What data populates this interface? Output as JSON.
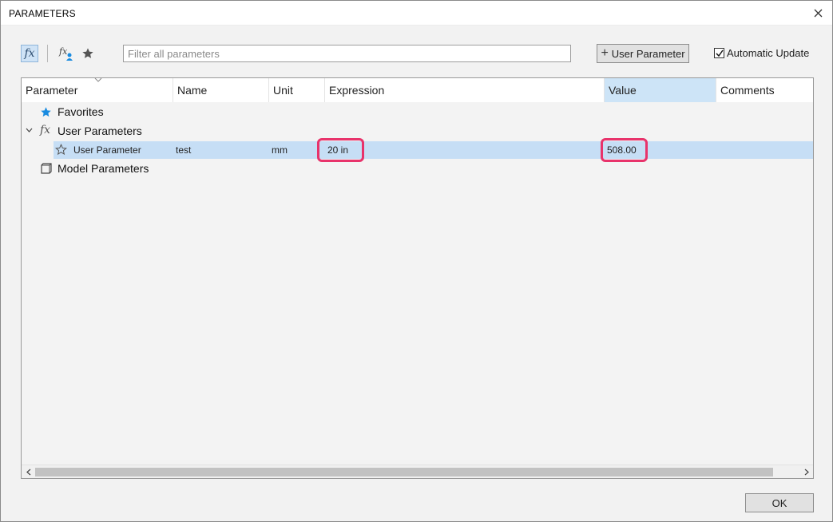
{
  "window": {
    "title": "PARAMETERS"
  },
  "toolbar": {
    "fx_glyph": "fx",
    "filter_placeholder": "Filter all parameters",
    "add_button_icon": "+",
    "add_button_label": "User Parameter",
    "auto_update_label": "Automatic Update",
    "auto_update_checked": true
  },
  "table": {
    "columns": [
      "Parameter",
      "Name",
      "Unit",
      "Expression",
      "Value",
      "Comments"
    ],
    "sorted_column": "Value",
    "groups": {
      "favorites": "Favorites",
      "user_parameters": "User Parameters",
      "model_parameters": "Model Parameters"
    },
    "rows": [
      {
        "parameter": "User Parameter",
        "name": "test",
        "unit": "mm",
        "expression": "20 in",
        "value": "508.00",
        "comments": ""
      }
    ]
  },
  "footer": {
    "ok_label": "OK"
  },
  "colors": {
    "accent": "#cde4f7",
    "selection": "#c6def5",
    "highlight_border": "#e8336b",
    "favorite_star": "#1a8be0"
  }
}
